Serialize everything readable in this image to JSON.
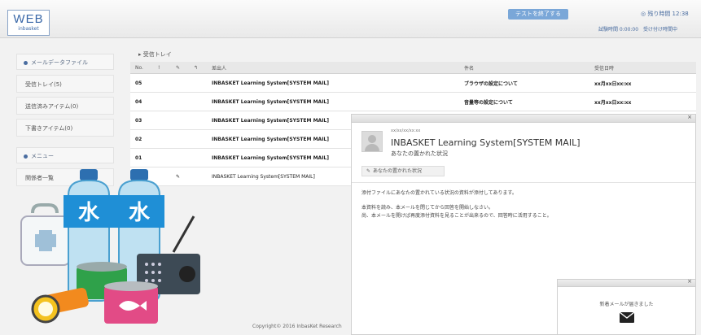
{
  "header": {
    "logo_main": "WEB",
    "logo_sub": "inbasket",
    "top_tab": "テストを終了する",
    "clock": "◎ 残り時間 12:38",
    "user_links": "試験時間 0:00:00　受け付け時間中"
  },
  "sidebar": {
    "section1_title": "メールデータファイル",
    "items": [
      {
        "label": "受信トレイ(5)"
      },
      {
        "label": "送信済みアイテム(0)"
      },
      {
        "label": "下書きアイテム(0)"
      }
    ],
    "section2_title": "メニュー",
    "items2": [
      {
        "label": "関係者一覧"
      }
    ]
  },
  "mail_list": {
    "folder_title": "▸ 受信トレイ",
    "columns": {
      "no": "No.",
      "flag": "!",
      "attach": "✎",
      "reply": "↰",
      "from": "差出人",
      "subject": "件名",
      "date": "受信日時"
    },
    "rows": [
      {
        "no": "05",
        "attach": "",
        "from": "INBASKET Learning System[SYSTEM MAIL]",
        "subject": "ブラウザの設定について",
        "date": "xx月xx日xx:xx"
      },
      {
        "no": "04",
        "attach": "",
        "from": "INBASKET Learning System[SYSTEM MAIL]",
        "subject": "音量等の設定について",
        "date": "xx月xx日xx:xx"
      },
      {
        "no": "03",
        "attach": "",
        "from": "INBASKET Learning System[SYSTEM MAIL]",
        "subject": "",
        "date": ""
      },
      {
        "no": "02",
        "attach": "",
        "from": "INBASKET Learning System[SYSTEM MAIL]",
        "subject": "",
        "date": ""
      },
      {
        "no": "01",
        "attach": "",
        "from": "INBASKET Learning System[SYSTEM MAIL]",
        "subject": "",
        "date": ""
      },
      {
        "no": "00",
        "attach": "✎",
        "from": "INBASKET Learning System[SYSTEM MAIL]",
        "subject": "",
        "date": ""
      }
    ]
  },
  "preview": {
    "date": "xx/xx/xx/xx:xx",
    "from": "INBASKET Learning System[SYSTEM MAIL]",
    "subject": "あなたの置かれた状況",
    "attachment": "あなたの置かれた状況",
    "body": [
      "添付ファイルにあなたの置かれている状況の資料が添付してあります。",
      "本資料を読み、本メールを閉じてから回答を開始しなさい。",
      "尚、本メールを開けば再度添付資料を見ることが出来るので、回答時に活用すること。"
    ]
  },
  "notification": {
    "text": "新着メールが届きました"
  },
  "footer": {
    "copyright": "Copyright© 2016 InbasKet Research"
  }
}
